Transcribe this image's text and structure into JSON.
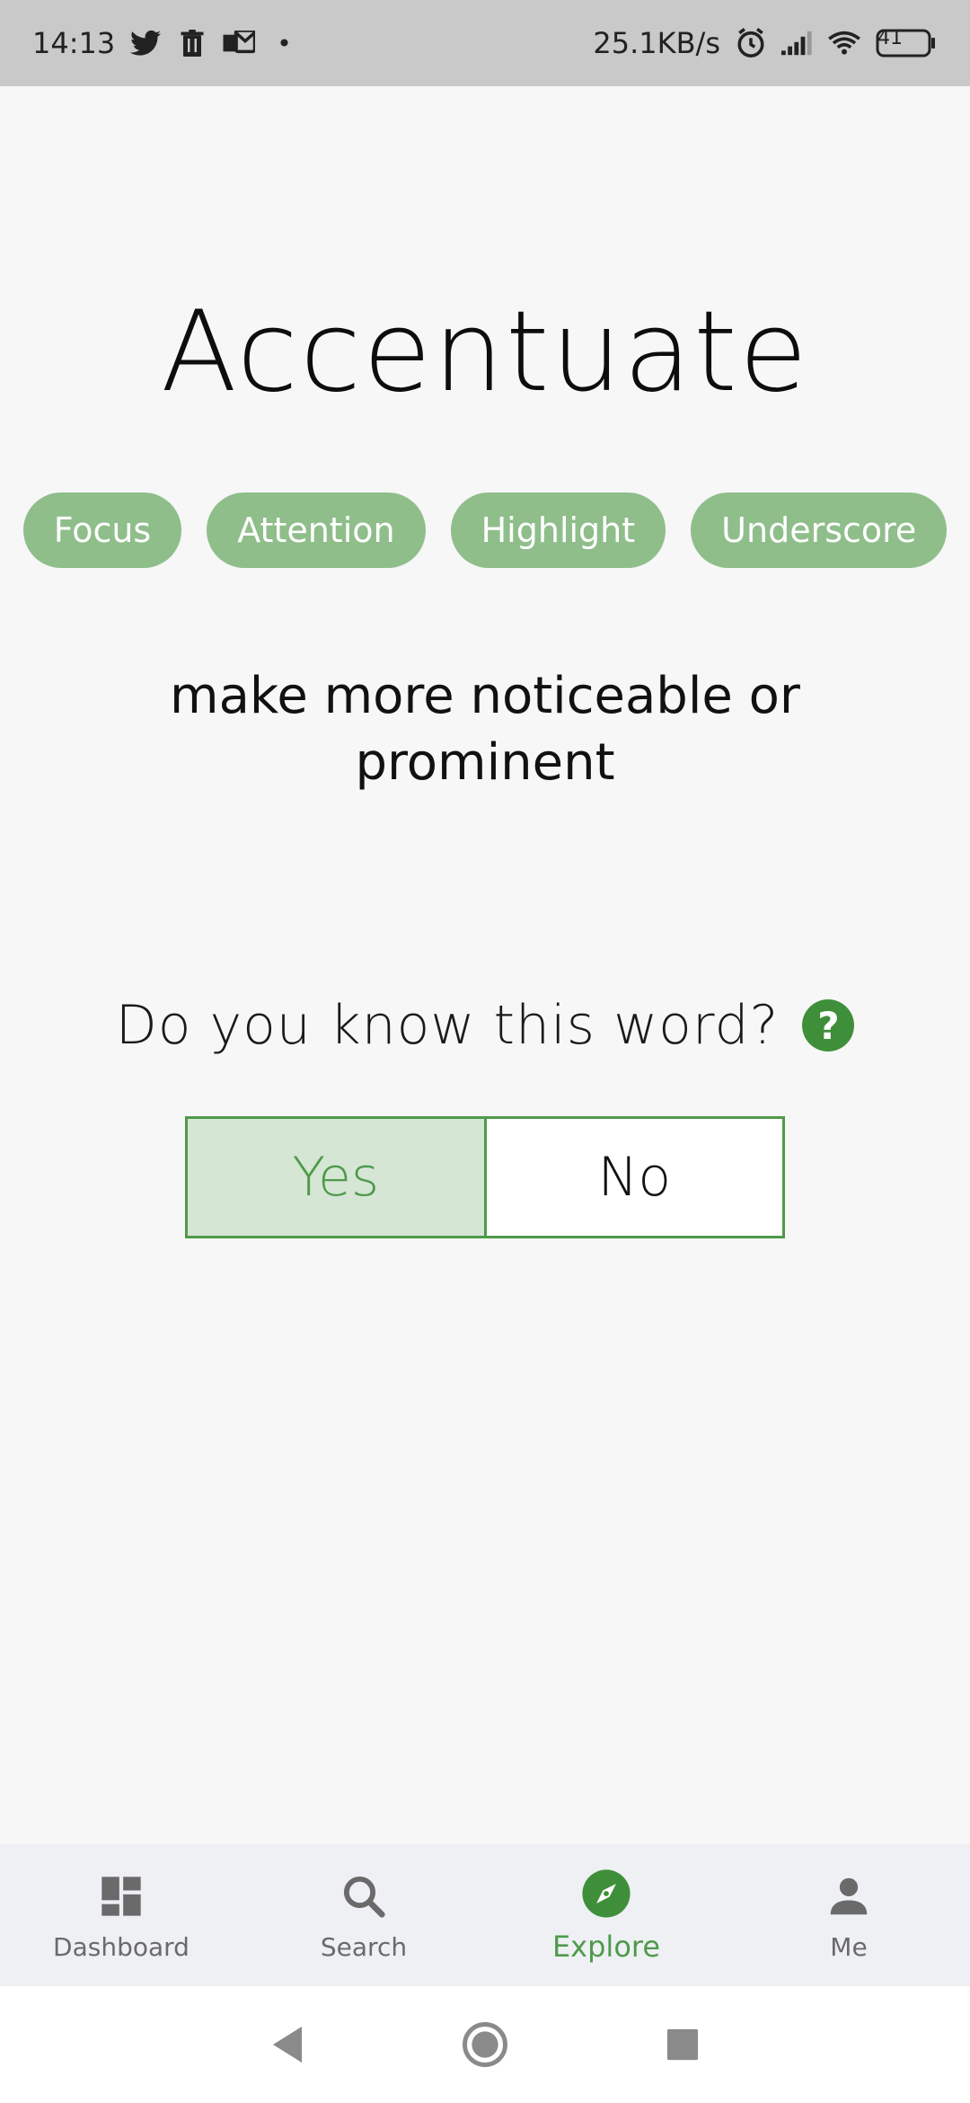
{
  "status_bar": {
    "time": "14:13",
    "network_speed": "25.1KB/s",
    "battery": "41",
    "icons": [
      "twitter-icon",
      "trash-icon",
      "mail-icon",
      "dot",
      "alarm-icon",
      "signal-icon",
      "wifi-icon",
      "battery-icon"
    ]
  },
  "word": {
    "title": "Accentuate",
    "synonyms": [
      "Focus",
      "Attention",
      "Highlight",
      "Underscore"
    ],
    "definition": "make more noticeable or prominent"
  },
  "question": {
    "text": "Do you know this word?",
    "help_icon": "?"
  },
  "answers": {
    "yes_label": "Yes",
    "no_label": "No",
    "selected": "Yes"
  },
  "bottom_nav": {
    "items": [
      {
        "label": "Dashboard",
        "icon": "dashboard-icon",
        "active": false
      },
      {
        "label": "Search",
        "icon": "search-icon",
        "active": false
      },
      {
        "label": "Explore",
        "icon": "compass-icon",
        "active": true
      },
      {
        "label": "Me",
        "icon": "person-icon",
        "active": false
      }
    ]
  },
  "colors": {
    "accent": "#4f9a4a",
    "chip": "#8fbe8b",
    "selected_answer_bg": "#d5e6d4",
    "status_bar_bg": "#c9c9c9",
    "nav_bg": "#eef0f4"
  }
}
